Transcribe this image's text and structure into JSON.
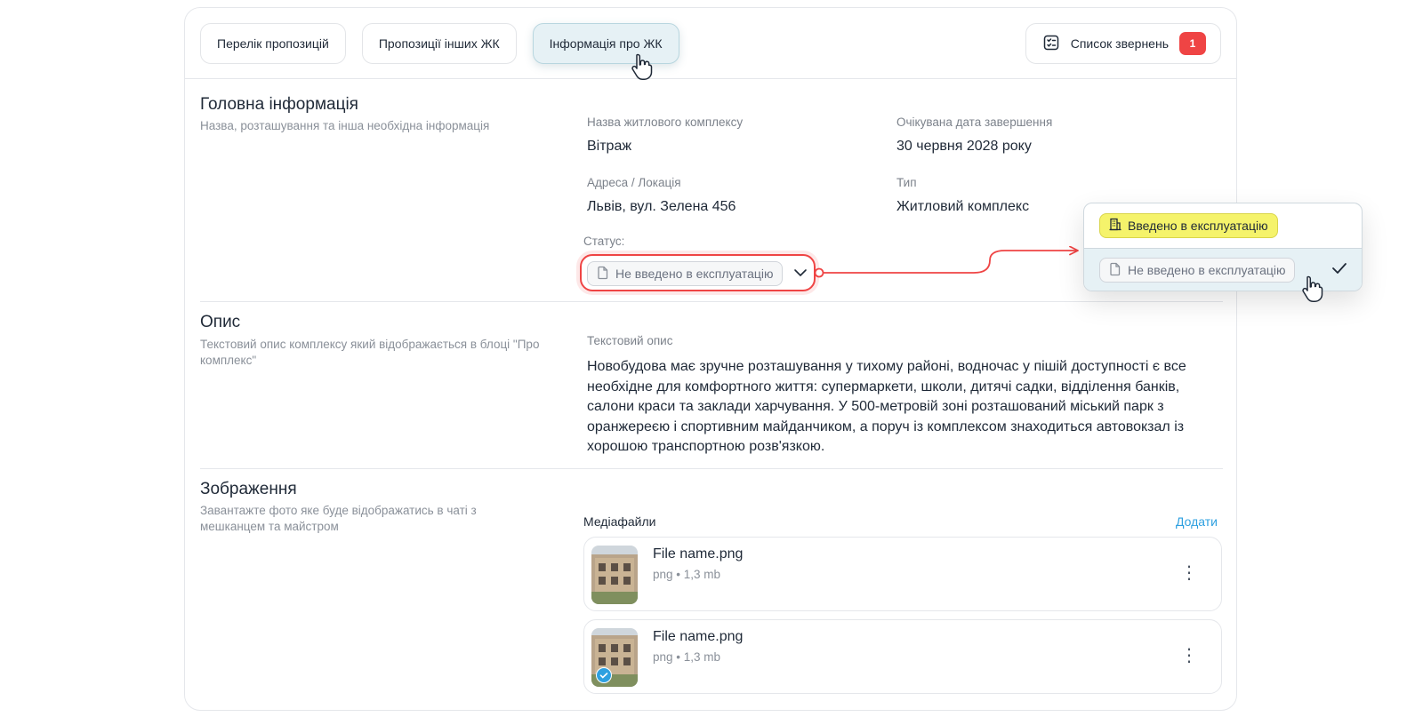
{
  "tabs": [
    {
      "label": "Перелік пропозицій"
    },
    {
      "label": "Пропозиції інших ЖК"
    },
    {
      "label": "Інформація про ЖК",
      "active": true
    }
  ],
  "requests": {
    "label": "Список звернень",
    "count": "1"
  },
  "main_info": {
    "title": "Головна інформація",
    "subtitle": "Назва, розташування та інша необхідна інформація",
    "fields": {
      "name_label": "Назва житлового комплексу",
      "name_value": "Вітраж",
      "date_label": "Очікувана дата завершення",
      "date_value": "30 червня 2028 року",
      "address_label": "Адреса / Локація",
      "address_value": "Львів, вул. Зелена 456",
      "type_label": "Тип",
      "type_value": "Житловий комплекс",
      "status_label": "Статус:",
      "status_value": "Не введено в експлуатацію"
    }
  },
  "status_dropdown": {
    "options": [
      {
        "label": "Введено в експлуатацію",
        "color": "#f5f36b"
      },
      {
        "label": "Не введено в експлуатацію",
        "selected": true
      }
    ]
  },
  "description": {
    "title": "Опис",
    "subtitle": "Текстовий опис комплексу який відображається в блоці \"Про комплекс\"",
    "label": "Текстовий опис",
    "text": "Новобудова має зручне розташування у тихому районі, водночас у пішій доступності є все необхідне для комфортного життя: супермаркети, школи, дитячі садки, відділення банків, салони краси та заклади харчування. У 500-метровій зоні розташований міський парк з оранжереєю і спортивним майданчиком, а поруч із комплексом знаходиться автовокзал із хорошою транспортною розв'язкою."
  },
  "images": {
    "title": "Зображення",
    "subtitle": "Завантажте фото яке буде відображатись в чаті з мешканцем та майстром",
    "media_label": "Медіафайли",
    "add_label": "Додати",
    "files": [
      {
        "name": "File name.png",
        "meta": "png • 1,3 mb"
      },
      {
        "name": "File name.png",
        "meta": "png • 1,3 mb"
      }
    ]
  },
  "colors": {
    "accent": "#2ea0e0",
    "highlight": "#ef4444",
    "active_tab": "#e6f1f5",
    "badge": "#ef4444"
  },
  "icons": [
    "checklist-icon",
    "document-icon",
    "building-icon",
    "chevron-down-icon",
    "check-icon",
    "kebab-menu-icon",
    "hand-cursor-icon",
    "verified-icon"
  ]
}
